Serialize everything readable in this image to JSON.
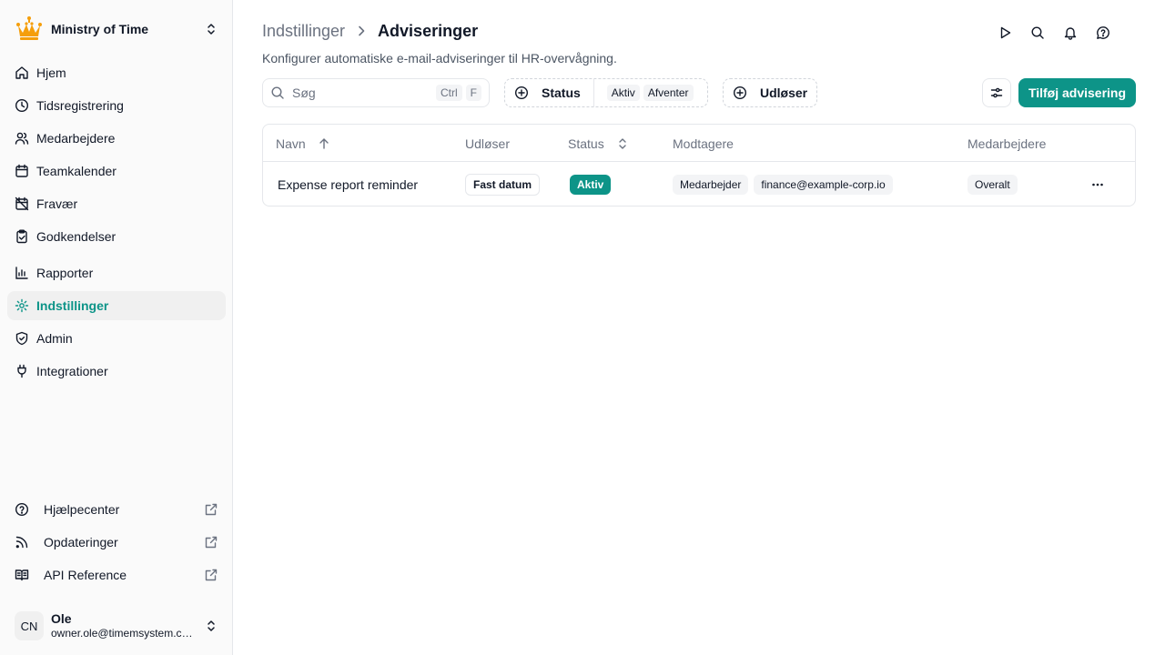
{
  "org": {
    "name": "Ministry of Time",
    "logo_icon": "crown-icon",
    "logo_color": "#f59e0b"
  },
  "sidebar": {
    "items": [
      {
        "label": "Hjem",
        "icon": "home-icon"
      },
      {
        "label": "Tidsregistrering",
        "icon": "clock-icon"
      },
      {
        "label": "Medarbejdere",
        "icon": "users-icon"
      },
      {
        "label": "Teamkalender",
        "icon": "calendar-icon"
      },
      {
        "label": "Fravær",
        "icon": "calendar-off-icon"
      },
      {
        "label": "Godkendelser",
        "icon": "clipboard-check-icon"
      },
      {
        "label": "Rapporter",
        "icon": "chart-icon"
      },
      {
        "label": "Indstillinger",
        "icon": "gear-icon",
        "active": true
      },
      {
        "label": "Admin",
        "icon": "shield-icon"
      },
      {
        "label": "Integrationer",
        "icon": "plug-icon"
      }
    ],
    "footer": [
      {
        "label": "Hjælpecenter",
        "icon": "help-circle-icon"
      },
      {
        "label": "Opdateringer",
        "icon": "rss-icon"
      },
      {
        "label": "API Reference",
        "icon": "book-icon"
      }
    ],
    "user": {
      "initials": "CN",
      "name": "Ole",
      "email": "owner.ole@timemsystem.com"
    }
  },
  "header": {
    "breadcrumb_parent": "Indstillinger",
    "breadcrumb_current": "Adviseringer",
    "subtitle": "Konfigurer automatiske e-mail-adviseringer til HR-overvågning."
  },
  "toolbar": {
    "search_placeholder": "Søg",
    "search_kbd_1": "Ctrl",
    "search_kbd_2": "F",
    "status_filter_label": "Status",
    "status_chips": [
      "Aktiv",
      "Afventer"
    ],
    "trigger_filter_label": "Udløser",
    "add_label": "Tilføj advisering"
  },
  "table": {
    "columns": [
      "Navn",
      "Udløser",
      "Status",
      "Modtagere",
      "Medarbejdere"
    ],
    "rows": [
      {
        "name": "Expense report reminder",
        "trigger": "Fast datum",
        "status": "Aktiv",
        "recipients": [
          "Medarbejder",
          "finance@example-corp.io"
        ],
        "employees": "Overalt"
      }
    ]
  },
  "colors": {
    "accent": "#0d9488",
    "text": "#111827",
    "muted": "#6b7280"
  }
}
